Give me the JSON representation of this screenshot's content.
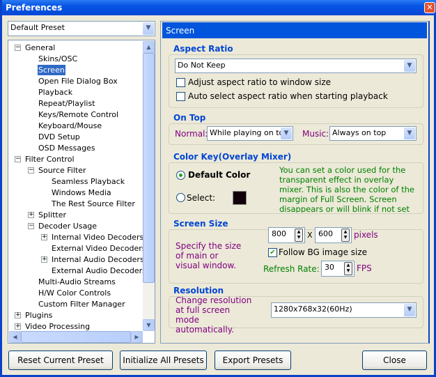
{
  "window": {
    "title": "Preferences",
    "close": "✕"
  },
  "preset": {
    "value": "Default Preset"
  },
  "tree": [
    {
      "label": "General",
      "depth": 0,
      "toggle": "-"
    },
    {
      "label": "Skins/OSC",
      "depth": 1
    },
    {
      "label": "Screen",
      "depth": 1,
      "selected": true
    },
    {
      "label": "Open File Dialog Box",
      "depth": 1
    },
    {
      "label": "Playback",
      "depth": 1
    },
    {
      "label": "Repeat/Playlist",
      "depth": 1
    },
    {
      "label": "Keys/Remote Control",
      "depth": 1
    },
    {
      "label": "Keyboard/Mouse",
      "depth": 1
    },
    {
      "label": "DVD Setup",
      "depth": 1
    },
    {
      "label": "OSD Messages",
      "depth": 1
    },
    {
      "label": "Filter Control",
      "depth": 0,
      "toggle": "-"
    },
    {
      "label": "Source Filter",
      "depth": 1,
      "toggle": "-"
    },
    {
      "label": "Seamless Playback",
      "depth": 2
    },
    {
      "label": "Windows Media",
      "depth": 2
    },
    {
      "label": "The Rest Source Filter",
      "depth": 2
    },
    {
      "label": "Splitter",
      "depth": 1,
      "toggle": "+"
    },
    {
      "label": "Decoder Usage",
      "depth": 1,
      "toggle": "-"
    },
    {
      "label": "Internal Video Decoders",
      "depth": 2,
      "toggle": "+"
    },
    {
      "label": "External Video Decoders",
      "depth": 2
    },
    {
      "label": "Internal Audio Decoders",
      "depth": 2,
      "toggle": "+"
    },
    {
      "label": "External Audio Decoders",
      "depth": 2
    },
    {
      "label": "Multi-Audio Streams",
      "depth": 1
    },
    {
      "label": "H/W Color Controls",
      "depth": 1
    },
    {
      "label": "Custom Filter Manager",
      "depth": 1
    },
    {
      "label": "Plugins",
      "depth": 0,
      "toggle": "+"
    },
    {
      "label": "Video Processing",
      "depth": 0,
      "toggle": "+"
    }
  ],
  "panel": {
    "title": "Screen",
    "aspect": {
      "legend": "Aspect Ratio",
      "value": "Do Not Keep",
      "adjust": "Adjust aspect ratio to window size",
      "adjust_checked": false,
      "auto": "Auto select aspect ratio when starting playback",
      "auto_checked": false
    },
    "ontop": {
      "legend": "On Top",
      "normal_label": "Normal:",
      "normal_value": "While playing on top",
      "music_label": "Music:",
      "music_value": "Always on top"
    },
    "colorkey": {
      "legend": "Color Key(Overlay Mixer)",
      "default": "Default Color",
      "select": "Select:",
      "swatch": "#10000a",
      "note": "You can set a color used for the transparent effect in overlay mixer. This is also the color of the margin of Full Screen. Screen disappears or will blink if not set properly."
    },
    "screensize": {
      "legend": "Screen Size",
      "desc": "Specify the size of main or visual window.",
      "width": "800",
      "x": "X",
      "height": "600",
      "unit": "pixels",
      "follow": "Follow BG image size",
      "follow_checked": true,
      "rate_label": "Refresh Rate:",
      "rate": "30",
      "rate_unit": "FPS"
    },
    "resolution": {
      "legend": "Resolution",
      "desc": "Change resolution at full screen mode automatically.",
      "value": "1280x768x32(60Hz)"
    }
  },
  "buttons": {
    "reset": "Reset Current Preset",
    "init": "Initialize All Presets",
    "export": "Export Presets",
    "close": "Close"
  }
}
